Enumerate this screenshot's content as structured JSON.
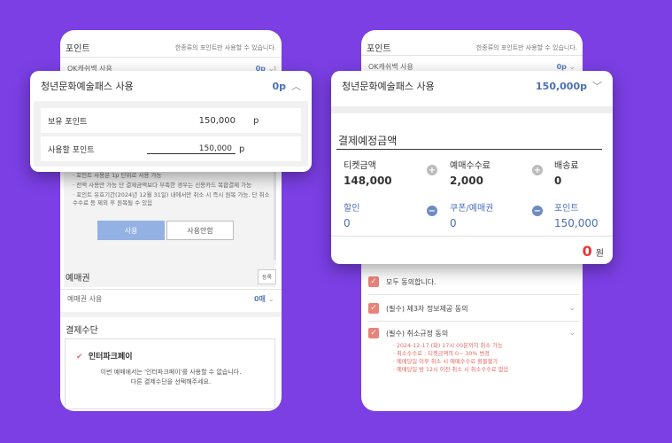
{
  "left_phone": {
    "point_section_title": "포인트",
    "point_note": "한종류의 포인트만 사용할 수 있습니다.",
    "ok_cashbag_label": "OK캐쉬백 사용",
    "ok_cashbag_value": "0p",
    "notes": [
      "· 포인트 사용은 1p 단위로 사용 가능",
      "· 전액 사용만 가능 단 결제금액보다 부족한 경우는 신용카드 복합결제 가능",
      "· 포인트 유효기간(2024년 12월 31일) 내에서만 취소 시 즉시 원복 가능. 단 취소 수수료 등 제외 후 원복될 수 있음"
    ],
    "use_button": "사용",
    "no_use_button": "사용안함",
    "ticket_section_title": "예매권",
    "register_button": "등록",
    "ticket_use_label": "예매권 사용",
    "ticket_use_value": "0매",
    "payment_section_title": "결제수단",
    "payment_method_name": "인터파크페이",
    "payment_desc_line1": "이번 예매에서는 '인터파크페이'를 사용할 수 없습니다.",
    "payment_desc_line2": "다른 결제수단을 선택해주세요."
  },
  "left_popup": {
    "title": "청년문화예술패스 사용",
    "value": "0p",
    "held_points_label": "보유 포인트",
    "held_points_value": "150,000",
    "held_points_unit": "p",
    "use_points_label": "사용할 포인트",
    "use_points_value": "150,000",
    "use_points_unit": "p"
  },
  "right_phone": {
    "point_section_title": "포인트",
    "point_note": "한종류의 포인트만 사용할 수 있습니다.",
    "ok_cashbag_label": "OK캐쉬백 사용",
    "ok_cashbag_value": "0p",
    "agree_all": "모두 동의합니다.",
    "agree_third_party": "(필수) 제3자 정보제공 동의",
    "agree_cancel_policy": "(필수) 취소규정 동의",
    "cancel_notes": [
      "· 2024-12-17 (화) 17시 00분까지 취소 가능",
      "· 취소수수료 : 티켓금액의 0~ 30% 변경",
      "· 예매당일 이후 취소 시 예매수수료 환불불가",
      "· 예매당일 밤 12시 이전 취소 시 취소수수료 없음"
    ]
  },
  "right_popup": {
    "title": "청년문화예술패스 사용",
    "value": "150,000p",
    "payment_title": "결제예정금액",
    "ticket_price_label": "티켓금액",
    "ticket_price_value": "148,000",
    "booking_fee_label": "예매수수료",
    "booking_fee_value": "2,000",
    "shipping_label": "배송료",
    "shipping_value": "0",
    "discount_label": "할인",
    "discount_value": "0",
    "coupon_label": "쿠폰/예매권",
    "coupon_value": "0",
    "point_label": "포인트",
    "point_value": "150,000",
    "total_value": "0",
    "total_unit": "원"
  },
  "colors": {
    "background": "#7b3fe4",
    "accent_blue": "#4a6fb5",
    "total_red": "#e53935",
    "check_red": "#e8837a",
    "button_blue": "#94b1e3"
  },
  "icons": [
    "chevron-up-icon",
    "chevron-down-icon",
    "check-icon",
    "plus-icon",
    "minus-icon"
  ]
}
